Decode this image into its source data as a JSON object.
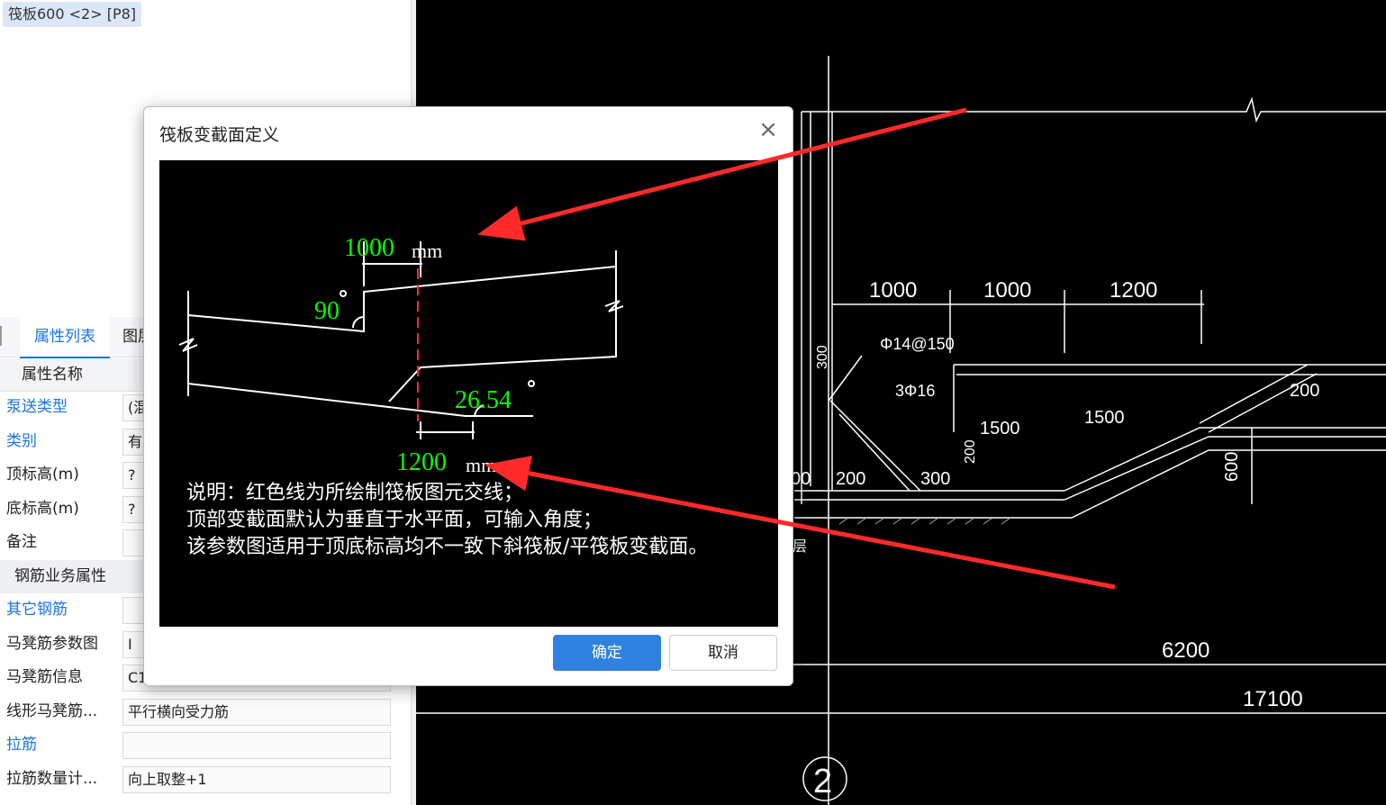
{
  "tree": {
    "selected_item": "筏板600 <2> [P8]"
  },
  "tabs": {
    "properties": "属性列表",
    "layers": "图层"
  },
  "prop_header": "属性名称",
  "properties": [
    {
      "name": "泵送类型",
      "value": "(混",
      "link": true
    },
    {
      "name": "类别",
      "value": "有",
      "link": true
    },
    {
      "name": "顶标高(m)",
      "value": "?",
      "link": false
    },
    {
      "name": "底标高(m)",
      "value": "?",
      "link": false
    },
    {
      "name": "备注",
      "value": "",
      "link": false
    }
  ],
  "section_rebar": "钢筋业务属性",
  "rebar_properties": [
    {
      "name": "其它钢筋",
      "value": "",
      "link": true
    },
    {
      "name": "马凳筋参数图",
      "value": "I",
      "link": false
    },
    {
      "name": "马凳筋信息",
      "value": "C1",
      "link": false
    },
    {
      "name": "线形马凳筋...",
      "value": "平行横向受力筋",
      "link": false
    },
    {
      "name": "拉筋",
      "value": "",
      "link": true
    },
    {
      "name": "拉筋数量计...",
      "value": "向上取整+1",
      "link": false
    }
  ],
  "dialog": {
    "title": "筏板变截面定义",
    "top_width": "1000",
    "top_unit": "mm",
    "top_angle": "90",
    "bottom_angle": "26.54",
    "bottom_width": "1200",
    "bottom_unit": "mm",
    "note_line1": "说明：红色线为所绘制筏板图元交线；",
    "note_line2": "顶部变截面默认为垂直于水平面，可输入角度；",
    "note_line3": "该参数图适用于顶底标高均不一致下斜筏板/平筏板变截面。",
    "ok_label": "确定",
    "cancel_label": "取消"
  },
  "cad": {
    "dims_top": [
      "1000",
      "1000",
      "1200"
    ],
    "rebar1": "Φ14@150",
    "rebar2": "3Φ16",
    "dim_300": "300",
    "dim_1500a": "1500",
    "dim_1500b": "1500",
    "dim_200a": "200",
    "dim_200b": "200",
    "dim_200c": "200",
    "dim_300b": "300",
    "dim_00": "00",
    "dim_600": "600",
    "dim_6200": "6200",
    "dim_17100": "17100",
    "axis_label": "2",
    "side_text": "层"
  },
  "colors": {
    "accent": "#1a73e8",
    "cad_green": "#00ff00",
    "arrow_red": "#ff2a2a"
  }
}
